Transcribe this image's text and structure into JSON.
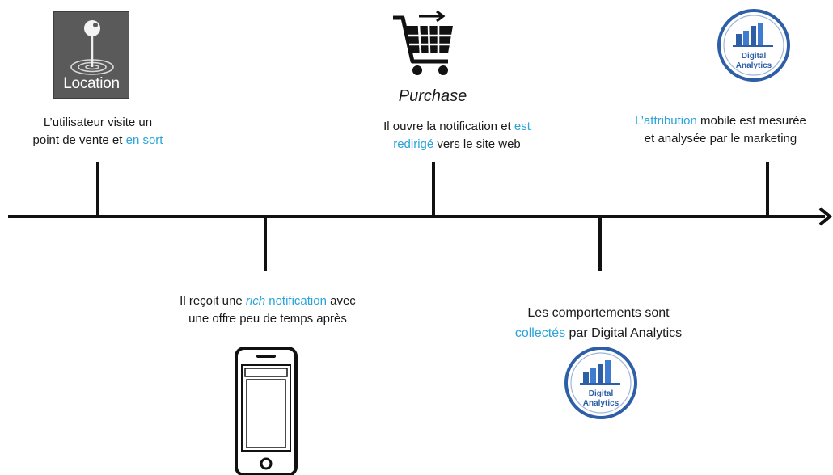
{
  "icons": {
    "location": "location-pin-icon",
    "cart": "shopping-cart-icon",
    "phone": "smartphone-icon",
    "analytics": "digital-analytics-badge-icon"
  },
  "colors": {
    "highlight": "#29a3d9",
    "line": "#111111",
    "badge_blue": "#2e5fa6"
  },
  "location_tile": {
    "label": "Location"
  },
  "purchase": {
    "label": "Purchase"
  },
  "badge": {
    "line1": "Digital",
    "line2": "Analytics"
  },
  "events": {
    "visit": {
      "pre": "L’utilisateur visite un point de vente et ",
      "hl": "en sort"
    },
    "notification": {
      "pre": "Il reçoit une ",
      "hl_rich": "rich",
      "hl_notif": " notification",
      "post_line1": " avec",
      "line2": "une offre peu de temps après"
    },
    "open": {
      "pre": "Il ouvre  la notification et ",
      "hl1": "est",
      "hl2": "redirigé",
      "post": " vers  le site web"
    },
    "collect": {
      "line1": "Les comportements sont",
      "hl": "collectés",
      "post": " par Digital Analytics"
    },
    "attribution": {
      "hl": "L’attribution",
      "post_line1": " mobile est mesurée",
      "line2": "et analysée par le marketing"
    }
  }
}
